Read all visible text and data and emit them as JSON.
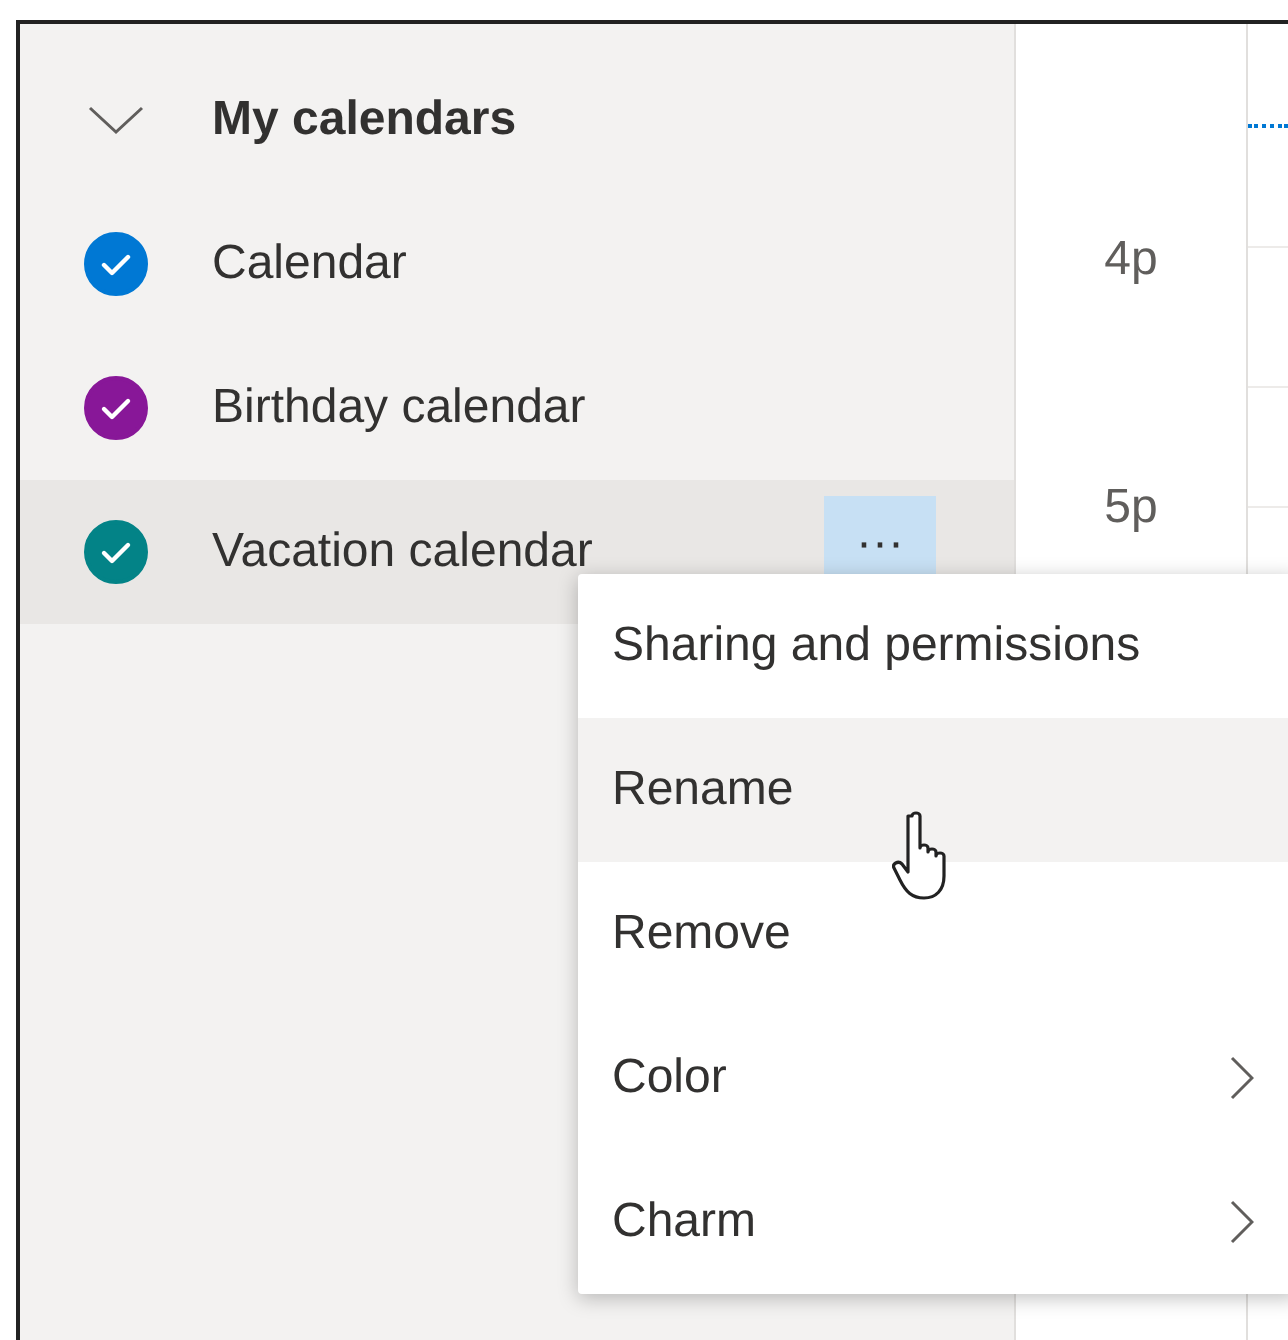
{
  "group": {
    "title": "My calendars",
    "expanded": true
  },
  "calendars": [
    {
      "name": "Calendar",
      "checked": true,
      "color": "#0078d4",
      "selected": false
    },
    {
      "name": "Birthday calendar",
      "checked": true,
      "color": "#881798",
      "selected": false
    },
    {
      "name": "Vacation calendar",
      "checked": true,
      "color": "#038387",
      "selected": true,
      "more_label": "···"
    }
  ],
  "time_labels": [
    {
      "label": "4p"
    },
    {
      "label": "5p"
    }
  ],
  "context_menu": {
    "items": [
      {
        "label": "Sharing and permissions",
        "hovered": false,
        "submenu": false
      },
      {
        "label": "Rename",
        "hovered": true,
        "submenu": false
      },
      {
        "label": "Remove",
        "hovered": false,
        "submenu": false
      },
      {
        "label": "Color",
        "hovered": false,
        "submenu": true
      },
      {
        "label": "Charm",
        "hovered": false,
        "submenu": true
      }
    ]
  }
}
